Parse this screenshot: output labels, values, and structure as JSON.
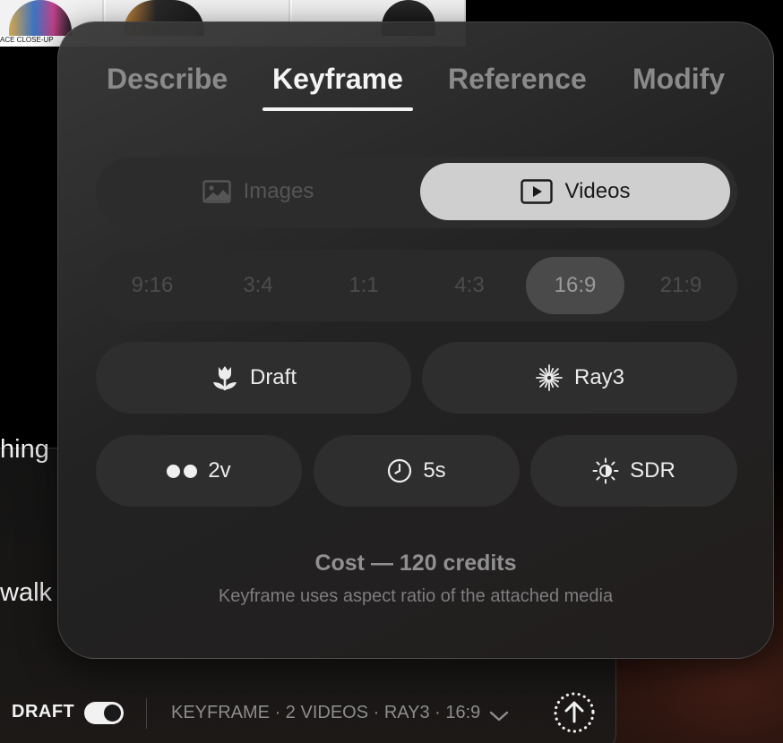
{
  "background": {
    "thumbnail_caption": "ACE CLOSE-UP",
    "prompt_fragment_1": "hing",
    "prompt_fragment_2": "walk"
  },
  "panel": {
    "tabs": [
      {
        "label": "Describe",
        "active": false
      },
      {
        "label": "Keyframe",
        "active": true
      },
      {
        "label": "Reference",
        "active": false
      },
      {
        "label": "Modify",
        "active": false
      }
    ],
    "media_type": {
      "options": [
        {
          "label": "Images",
          "icon": "image-icon",
          "selected": false
        },
        {
          "label": "Videos",
          "icon": "play-icon",
          "selected": true
        }
      ]
    },
    "aspect_ratios": {
      "options": [
        "9:16",
        "3:4",
        "1:1",
        "4:3",
        "16:9",
        "21:9"
      ],
      "selected": "16:9"
    },
    "quality": {
      "label": "Draft",
      "icon": "tulip-icon"
    },
    "model": {
      "label": "Ray3",
      "icon": "starburst-icon"
    },
    "variants": {
      "label": "2v",
      "icon": "two-dots-icon"
    },
    "duration": {
      "label": "5s",
      "icon": "clock-icon"
    },
    "dynamic_range": {
      "label": "SDR",
      "icon": "sun-icon"
    },
    "cost": "Cost — 120 credits",
    "hint": "Keyframe uses aspect ratio of the attached media"
  },
  "bottom_bar": {
    "draft_label": "DRAFT",
    "draft_toggle_on": true,
    "summary": "KEYFRAME · 2 VIDEOS · RAY3 · 16:9",
    "submit_icon": "arrow-up-icon"
  },
  "colors": {
    "active_text": "#f4f4f4",
    "inactive_text": "#8a8a8a",
    "selected_segment": "#cfcfcf"
  }
}
